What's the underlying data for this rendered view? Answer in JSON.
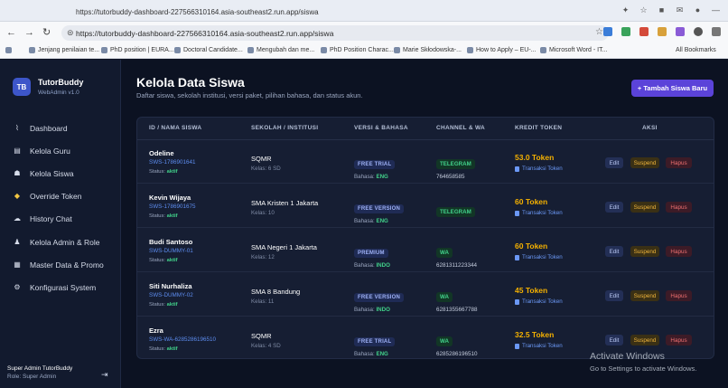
{
  "browser": {
    "tab_title": "https://tutorbuddy-dashboard-227566310164.asia-southeast2.run.app/siswa",
    "url": "https://tutorbuddy-dashboard-227566310164.asia-southeast2.run.app/siswa",
    "bookmarks": [
      "Jenjang penilaian te...",
      "PhD position | EURA...",
      "Doctoral Candidate...",
      "Mengubah dan me...",
      "PhD Position Charac...",
      "Marie Skłodowska-...",
      "How to Apply – EU-...",
      "Microsoft Word - IT..."
    ],
    "all_bookmarks": "All Bookmarks"
  },
  "sidebar": {
    "logo": "TB",
    "brand": "TutorBuddy",
    "brand_sub": "WebAdmin v1.0",
    "items": [
      {
        "label": "Dashboard",
        "icon": "chart-icon"
      },
      {
        "label": "Kelola Guru",
        "icon": "teacher-icon"
      },
      {
        "label": "Kelola Siswa",
        "icon": "student-icon"
      },
      {
        "label": "Override Token",
        "icon": "coin-icon"
      },
      {
        "label": "History Chat",
        "icon": "chat-icon"
      },
      {
        "label": "Kelola Admin & Role",
        "icon": "admin-icon"
      },
      {
        "label": "Master Data & Promo",
        "icon": "database-icon"
      },
      {
        "label": "Konfigurasi System",
        "icon": "gear-icon"
      }
    ],
    "user_name": "Super Admin TutorBuddy",
    "user_role": "Role: Super Admin"
  },
  "page": {
    "title": "Kelola Data Siswa",
    "subtitle": "Daftar siswa, sekolah institusi, versi paket, pilihan bahasa, dan status akun.",
    "add_button": "+ Tambah Siswa Baru"
  },
  "table": {
    "headers": [
      "ID / NAMA SISWA",
      "SEKOLAH / INSTITUSI",
      "VERSI & BAHASA",
      "CHANNEL & WA",
      "KREDIT TOKEN",
      "AKSI"
    ],
    "status_label": "Status:",
    "bahasa_label": "Bahasa:",
    "trx_label": "Transaksi Token",
    "actions": {
      "edit": "Edit",
      "suspend": "Suspend",
      "hapus": "Hapus"
    },
    "rows": [
      {
        "name": "Odeline",
        "id": "SWS-1786901641",
        "status": "aktif",
        "school": "SQMR",
        "kelas": "Kelas: 6 SD",
        "version": "FREE TRIAL",
        "bahasa": "ENG",
        "channel": "TELEGRAM",
        "wa": "764658585",
        "token": "53.0 Token"
      },
      {
        "name": "Kevin Wijaya",
        "id": "SWS-1786901675",
        "status": "aktif",
        "school": "SMA Kristen 1 Jakarta",
        "kelas": "Kelas: 10",
        "version": "FREE VERSION",
        "bahasa": "ENG",
        "channel": "TELEGRAM",
        "wa": "",
        "token": "60 Token"
      },
      {
        "name": "Budi Santoso",
        "id": "SWS-DUMMY-01",
        "status": "aktif",
        "school": "SMA Negeri 1 Jakarta",
        "kelas": "Kelas: 12",
        "version": "PREMIUM",
        "bahasa": "INDO",
        "channel": "WA",
        "wa": "6281311223344",
        "token": "60 Token"
      },
      {
        "name": "Siti Nurhaliza",
        "id": "SWS-DUMMY-02",
        "status": "aktif",
        "school": "SMA 8 Bandung",
        "kelas": "Kelas: 11",
        "version": "FREE VERSION",
        "bahasa": "INDO",
        "channel": "WA",
        "wa": "6281355667788",
        "token": "45 Token"
      },
      {
        "name": "Ezra",
        "id": "SWS-WA-6285286196510",
        "status": "aktif",
        "school": "SQMR",
        "kelas": "Kelas: 4 SD",
        "version": "FREE TRIAL",
        "bahasa": "ENG",
        "channel": "WA",
        "wa": "6285286196510",
        "token": "32.5 Token"
      }
    ]
  },
  "watermark": {
    "line1": "Activate Windows",
    "line2": "Go to Settings to activate Windows."
  }
}
